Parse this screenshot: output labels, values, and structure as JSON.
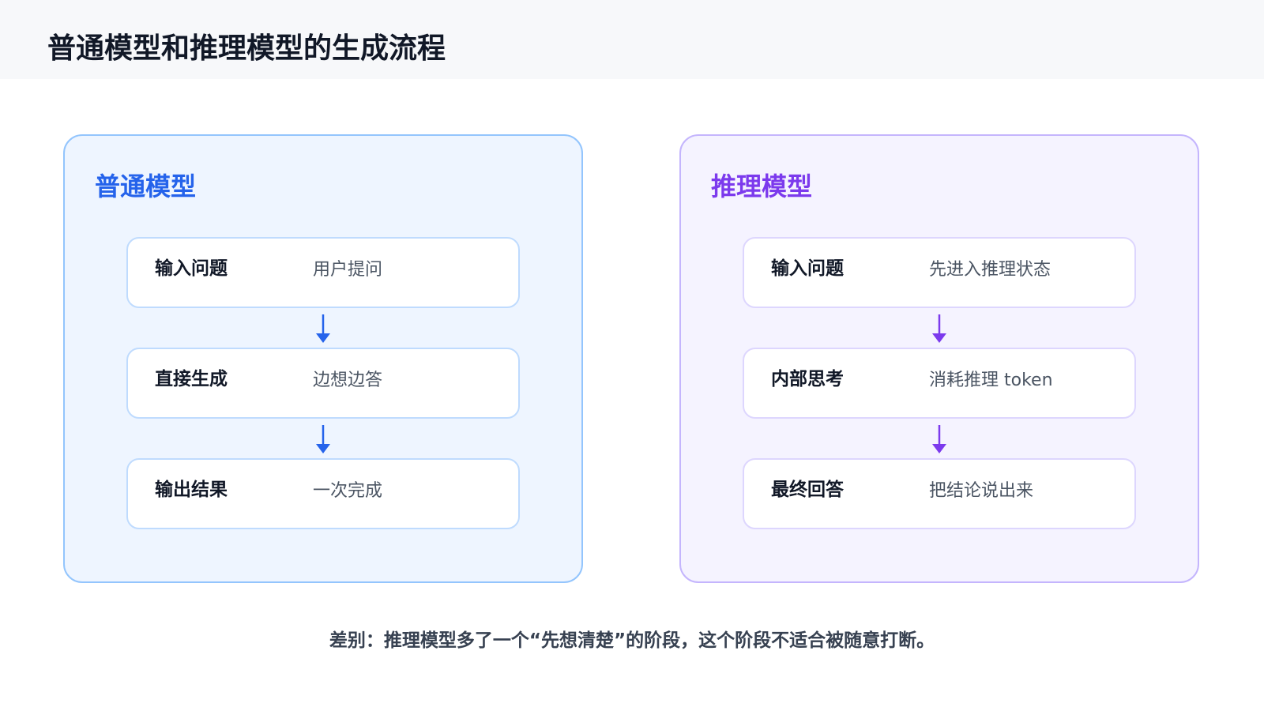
{
  "title": "普通模型和推理模型的生成流程",
  "colors": {
    "normal_accent": "#2563eb",
    "reason_accent": "#7c3aed"
  },
  "panels": [
    {
      "title": "普通模型",
      "steps": [
        {
          "name": "输入问题",
          "desc": "用户提问"
        },
        {
          "name": "直接生成",
          "desc": "边想边答"
        },
        {
          "name": "输出结果",
          "desc": "一次完成"
        }
      ]
    },
    {
      "title": "推理模型",
      "steps": [
        {
          "name": "输入问题",
          "desc": "先进入推理状态"
        },
        {
          "name": "内部思考",
          "desc": "消耗推理 token"
        },
        {
          "name": "最终回答",
          "desc": "把结论说出来"
        }
      ]
    }
  ],
  "footer": "差别：推理模型多了一个“先想清楚”的阶段，这个阶段不适合被随意打断。"
}
